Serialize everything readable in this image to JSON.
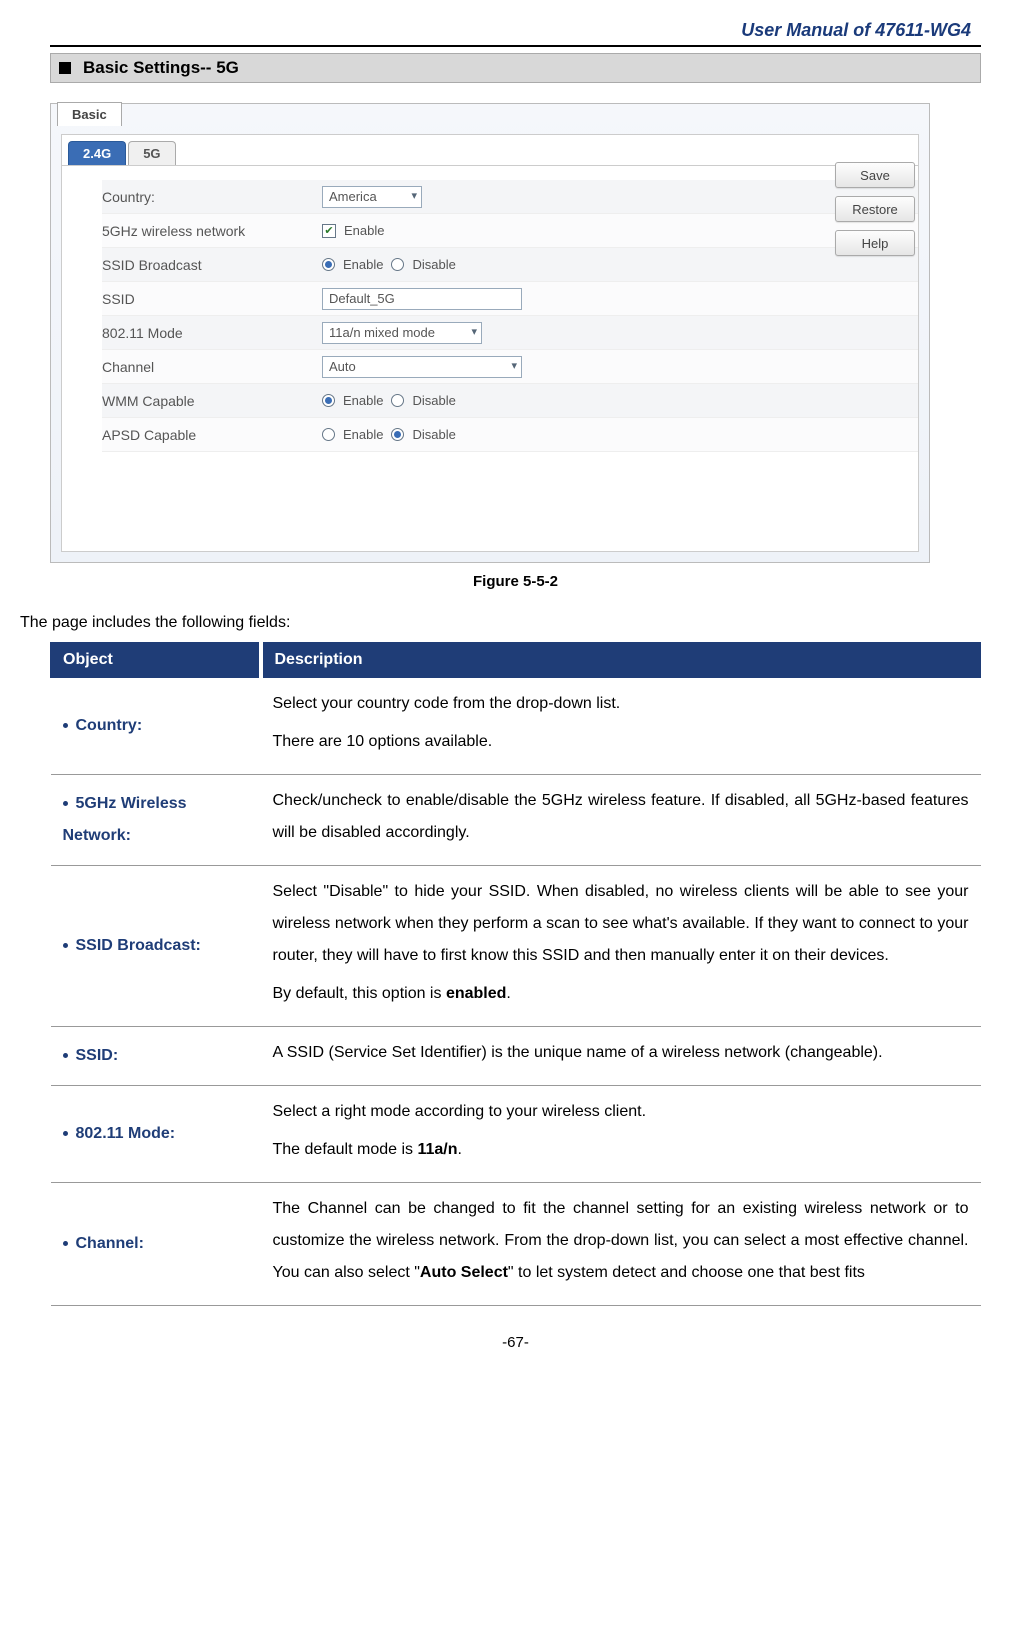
{
  "doc_title": "User Manual of 47611-WG4",
  "section_title": "Basic Settings-- 5G",
  "figure_caption": "Figure 5-5-2",
  "intro_text": "The page includes the following fields:",
  "page_number": "-67-",
  "screenshot": {
    "top_tab": "Basic",
    "band_tabs": {
      "t24g": "2.4G",
      "t5g": "5G"
    },
    "buttons": {
      "save": "Save",
      "restore": "Restore",
      "help": "Help"
    },
    "rows": {
      "country": {
        "label": "Country:",
        "value": "America"
      },
      "wireless5g": {
        "label": "5GHz wireless network",
        "value": "Enable"
      },
      "ssid_broadcast": {
        "label": "SSID Broadcast",
        "enable": "Enable",
        "disable": "Disable"
      },
      "ssid": {
        "label": "SSID",
        "value": "Default_5G"
      },
      "mode": {
        "label": "802.11 Mode",
        "value": "11a/n mixed mode"
      },
      "channel": {
        "label": "Channel",
        "value": "Auto"
      },
      "wmm": {
        "label": "WMM Capable",
        "enable": "Enable",
        "disable": "Disable"
      },
      "apsd": {
        "label": "APSD Capable",
        "enable": "Enable",
        "disable": "Disable"
      }
    }
  },
  "table": {
    "header_object": "Object",
    "header_description": "Description",
    "rows": {
      "country": {
        "object": "Country:",
        "p1": "Select your country code from the drop-down list.",
        "p2": "There are 10 options available."
      },
      "wireless5g": {
        "object": "5GHz Wireless Network:",
        "p1": "Check/uncheck to enable/disable the 5GHz wireless feature. If disabled, all 5GHz-based features will be disabled accordingly."
      },
      "ssid_broadcast": {
        "object": "SSID Broadcast:",
        "p1": "Select \"Disable\" to hide your SSID. When disabled, no wireless clients will be able to see your wireless network when they perform a scan to see what's available. If they want to connect to your router, they will have to first know this SSID and then manually enter it on their devices.",
        "p2_prefix": "By default, this option is ",
        "p2_bold": "enabled",
        "p2_suffix": "."
      },
      "ssid": {
        "object": "SSID:",
        "p1": "A SSID (Service Set Identifier) is the unique name of a wireless network (changeable)."
      },
      "mode": {
        "object": "802.11 Mode:",
        "p1": "Select a right mode according to your wireless client.",
        "p2_prefix": "The default mode is ",
        "p2_bold": "11a/n",
        "p2_suffix": "."
      },
      "channel": {
        "object": "Channel:",
        "p1_prefix": "The Channel can be changed to fit the channel setting for an existing wireless network or to customize the wireless network. From the drop-down list, you can select a most effective channel. You can also select \"",
        "p1_bold": "Auto Select",
        "p1_suffix": "\" to let system detect and choose one that best fits"
      }
    }
  }
}
